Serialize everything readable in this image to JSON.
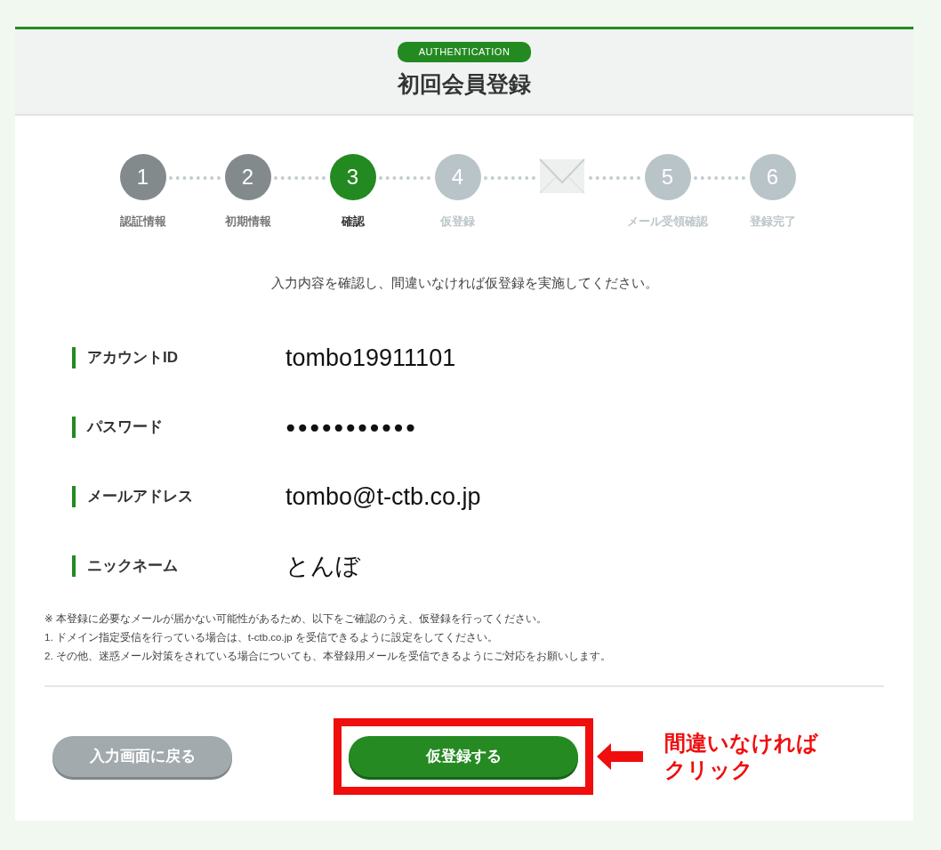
{
  "header": {
    "badge": "AUTHENTICATION",
    "title": "初回会員登録"
  },
  "steps": [
    {
      "kind": "number",
      "number": "1",
      "label": "認証情報",
      "completed": true,
      "selected": false
    },
    {
      "kind": "number",
      "number": "2",
      "label": "初期情報",
      "completed": true,
      "selected": false
    },
    {
      "kind": "number",
      "number": "3",
      "label": "確認",
      "completed": false,
      "selected": true
    },
    {
      "kind": "number",
      "number": "4",
      "label": "仮登録",
      "completed": false,
      "selected": false
    },
    {
      "kind": "mail",
      "completed": false,
      "selected": false
    },
    {
      "kind": "number",
      "number": "5",
      "label": "メール受領確認",
      "completed": false,
      "selected": false
    },
    {
      "kind": "number",
      "number": "6",
      "label": "登録完了",
      "completed": false,
      "selected": false
    }
  ],
  "instruction": "入力内容を確認し、間違いなければ仮登録を実施してください。",
  "fields": [
    {
      "label": "アカウントID",
      "value": "tombo19911101",
      "kind": "text"
    },
    {
      "label": "パスワード",
      "value": "●●●●●●●●●●●",
      "kind": "masked"
    },
    {
      "label": "メールアドレス",
      "value": "tombo@t-ctb.co.jp",
      "kind": "text"
    },
    {
      "label": "ニックネーム",
      "value": "とんぼ",
      "kind": "text"
    }
  ],
  "notes": [
    "※ 本登録に必要なメールが届かない可能性があるため、以下をご確認のうえ、仮登録を行ってください。",
    "1. ドメイン指定受信を行っている場合は、t-ctb.co.jp を受信できるように設定をしてください。",
    "2. その他、迷惑メール対策をされている場合についても、本登録用メールを受信できるようにご対応をお願いします。"
  ],
  "buttons": {
    "back": "入力画面に戻る",
    "submit": "仮登録する"
  },
  "annotation": {
    "lines": [
      "間違いなければ",
      "クリック"
    ]
  }
}
